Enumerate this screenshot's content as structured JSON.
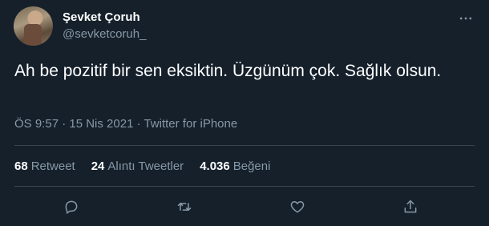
{
  "user": {
    "display_name": "Şevket Çoruh",
    "handle": "@sevketcoruh_"
  },
  "tweet": {
    "text": "Ah be pozitif bir sen eksiktin.  Üzgünüm çok. Sağlık olsun.",
    "timestamp": "ÖS 9:57 · 15 Nis 2021 · Twitter for iPhone"
  },
  "stats": {
    "retweets_count": "68",
    "retweets_label": "Retweet",
    "quotes_count": "24",
    "quotes_label": "Alıntı Tweetler",
    "likes_count": "4.036",
    "likes_label": "Beğeni"
  },
  "icons": {
    "more": "more-icon",
    "reply": "reply-icon",
    "retweet": "retweet-icon",
    "like": "heart-icon",
    "share": "share-icon"
  },
  "colors": {
    "background": "#15202b",
    "text": "#ffffff",
    "secondary_text": "#8899a6",
    "divider": "#38444d"
  }
}
